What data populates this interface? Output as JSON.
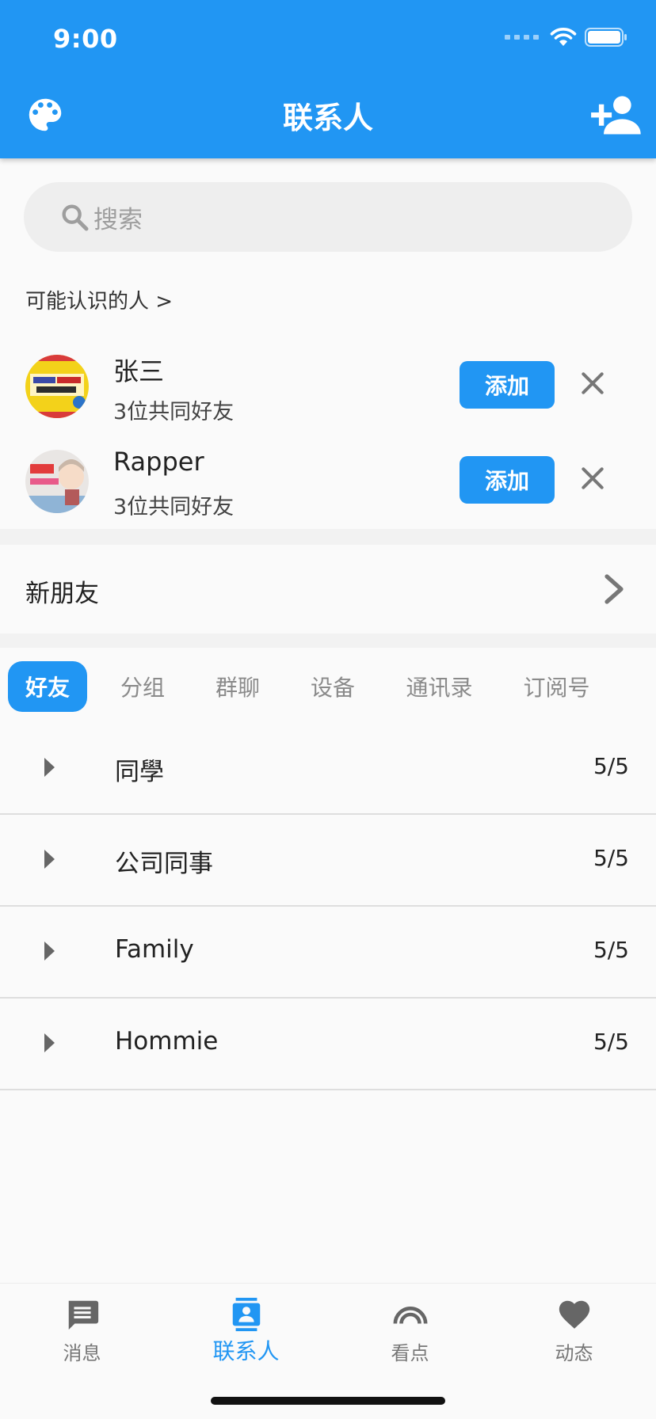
{
  "status_bar": {
    "time": "9:00"
  },
  "app_bar": {
    "title": "联系人"
  },
  "search": {
    "placeholder": "搜索"
  },
  "suggestions": {
    "header": "可能认识的人 >",
    "items": [
      {
        "name": "张三",
        "subtitle": "3位共同好友",
        "add_label": "添加"
      },
      {
        "name": "Rapper",
        "subtitle": "3位共同好友",
        "add_label": "添加"
      }
    ]
  },
  "new_friends": {
    "label": "新朋友"
  },
  "tabs": [
    {
      "label": "好友",
      "active": true
    },
    {
      "label": "分组",
      "active": false
    },
    {
      "label": "群聊",
      "active": false
    },
    {
      "label": "设备",
      "active": false
    },
    {
      "label": "通讯录",
      "active": false
    },
    {
      "label": "订阅号",
      "active": false
    }
  ],
  "groups": [
    {
      "name": "同學",
      "count": "5/5"
    },
    {
      "name": "公司同事",
      "count": "5/5"
    },
    {
      "name": "Family",
      "count": "5/5"
    },
    {
      "name": "Hommie",
      "count": "5/5"
    }
  ],
  "bottom_nav": [
    {
      "label": "消息",
      "icon": "message-icon",
      "active": false
    },
    {
      "label": "联系人",
      "icon": "contacts-icon",
      "active": true
    },
    {
      "label": "看点",
      "icon": "rainbow-icon",
      "active": false
    },
    {
      "label": "动态",
      "icon": "heart-icon",
      "active": false
    }
  ],
  "colors": {
    "primary": "#2196f3",
    "background": "#fafafa",
    "inactive": "#777777"
  }
}
